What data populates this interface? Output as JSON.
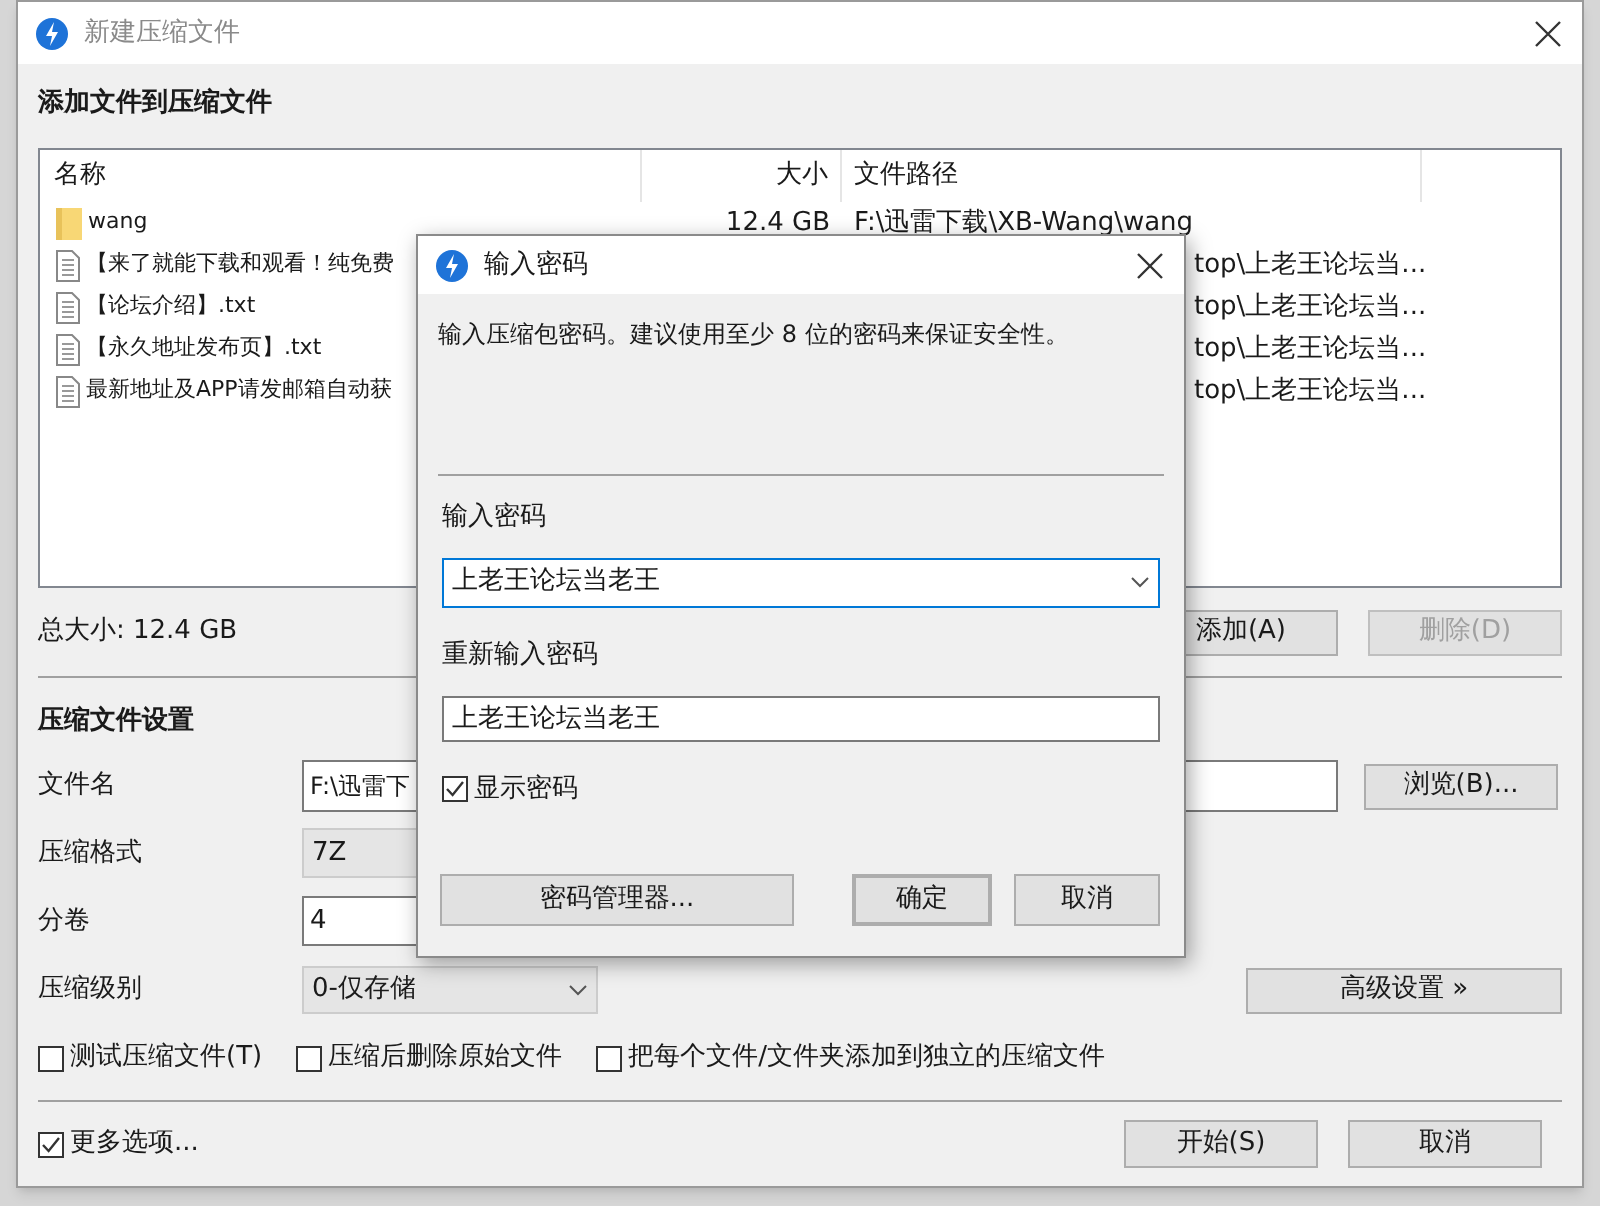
{
  "window": {
    "title": "新建压缩文件"
  },
  "files": {
    "heading": "添加文件到压缩文件",
    "columns": [
      "名称",
      "大小",
      "文件路径"
    ],
    "rows": [
      {
        "kind": "folder",
        "name": "wang",
        "size": "12.4 GB",
        "path": "F:\\迅雷下载\\XB-Wang\\wang",
        "covered": false
      },
      {
        "kind": "file",
        "name": "【来了就能下载和观看！纯免费",
        "path": "top\\上老王论坛当...",
        "covered": true
      },
      {
        "kind": "file",
        "name": "【论坛介绍】.txt",
        "path": "top\\上老王论坛当...",
        "covered": true
      },
      {
        "kind": "file",
        "name": "【永久地址发布页】.txt",
        "path": "top\\上老王论坛当...",
        "covered": true
      },
      {
        "kind": "file",
        "name": "最新地址及APP请发邮箱自动获",
        "path": "top\\上老王论坛当...",
        "covered": true
      }
    ]
  },
  "total_size": "总大小: 12.4 GB",
  "list_buttons": [
    {
      "label": "添加(A)",
      "disabled": false
    },
    {
      "label": "删除(D)",
      "disabled": true
    }
  ],
  "settings": {
    "heading": "压缩文件设置",
    "file_name": {
      "label": "文件名",
      "value": "F:\\迅雷下",
      "button": "浏览(B)..."
    },
    "format": {
      "label": "压缩格式",
      "value": "7Z"
    },
    "volumes": {
      "label": "分卷",
      "value": "4"
    },
    "level": {
      "label": "压缩级别",
      "value": "0-仅存储",
      "button": "高级设置 »"
    },
    "options": [
      {
        "label": "测试压缩文件(T)",
        "checked": false
      },
      {
        "label": "压缩后删除原始文件",
        "checked": false
      },
      {
        "label": "把每个文件/文件夹添加到独立的压缩文件",
        "checked": false
      }
    ]
  },
  "more_options": {
    "label": "更多选项...",
    "checked": true
  },
  "footer_buttons": [
    "开始(S)",
    "取消"
  ],
  "dialog": {
    "title": "输入密码",
    "message": "输入压缩包密码。建议使用至少 8 位的密码来保证安全性。",
    "password_label": "输入密码",
    "password": "上老王论坛当老王",
    "confirm_label": "重新输入密码",
    "confirm": "上老王论坛当老王",
    "show_password": {
      "label": "显示密码",
      "checked": true
    },
    "buttons": [
      {
        "label": "密码管理器...",
        "default": false
      },
      {
        "label": "确定",
        "default": true
      },
      {
        "label": "取消",
        "default": false
      }
    ]
  }
}
